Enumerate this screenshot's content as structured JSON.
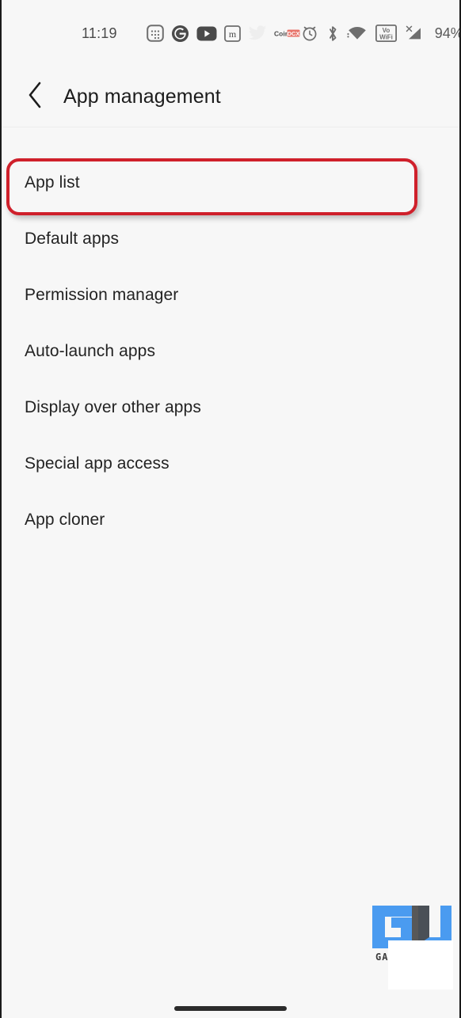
{
  "status_bar": {
    "time": "11:19",
    "battery_percent": "94%",
    "left_icons": [
      {
        "name": "calendar-notification-icon",
        "label": "Calendar"
      },
      {
        "name": "google-notification-icon",
        "label": "G"
      },
      {
        "name": "youtube-notification-icon",
        "label": "YouTube"
      },
      {
        "name": "mint-notification-icon",
        "label": "m"
      },
      {
        "name": "twitter-notification-icon",
        "label": "Twitter"
      },
      {
        "name": "coindcx-notification-icon",
        "label": "CoinDCX"
      }
    ],
    "right_icons": [
      {
        "name": "alarm-icon",
        "label": "Alarm"
      },
      {
        "name": "bluetooth-icon",
        "label": "Bluetooth"
      },
      {
        "name": "wifi-icon",
        "label": "Wi-Fi"
      },
      {
        "name": "vowifi-icon",
        "label": "VoWiFi"
      },
      {
        "name": "cellular-signal-icon",
        "label": "No SIM signal"
      },
      {
        "name": "battery-icon",
        "label": "Battery"
      }
    ]
  },
  "header": {
    "back_icon": "chevron-left-icon",
    "title": "App management"
  },
  "list": {
    "items": [
      {
        "label": "App list",
        "highlighted": true
      },
      {
        "label": "Default apps",
        "highlighted": false
      },
      {
        "label": "Permission manager",
        "highlighted": false
      },
      {
        "label": "Auto-launch apps",
        "highlighted": false
      },
      {
        "label": "Display over other apps",
        "highlighted": false
      },
      {
        "label": "Special app access",
        "highlighted": false
      },
      {
        "label": "App cloner",
        "highlighted": false
      }
    ]
  },
  "annotation": {
    "highlight_color": "#cf202b",
    "target_label": "App list"
  },
  "watermark": {
    "text": "GADG",
    "logo_name": "gadgets-to-use-logo",
    "blue": "#4a9bf0",
    "gray": "#4a4a4a"
  },
  "navigation": {
    "gesture_pill": "home-gesture-pill"
  },
  "colors": {
    "background": "#f7f7f7",
    "text_primary": "#232323",
    "title": "#1c1c1c",
    "accent_red": "#cf202b"
  }
}
